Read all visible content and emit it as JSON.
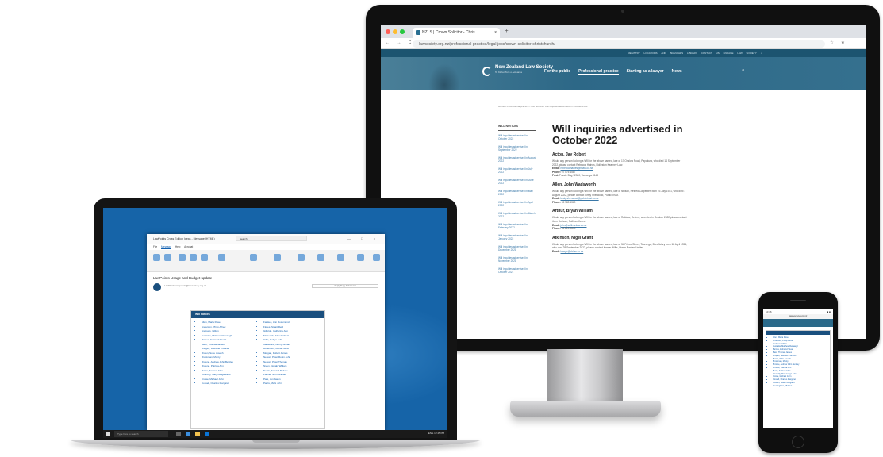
{
  "monitor": {
    "browser": {
      "tab_title": "NZLS | Crown Solicitor - Chris…",
      "tab_close": "×",
      "new_tab": "+",
      "nav_glyphs": "← → C",
      "url": "lawsociety.org.nz/professional-practice/legal-jobs/crown-solicitor-christchurch/",
      "right_glyphs": "☆ ★ ⋮"
    },
    "site": {
      "utility_links": "REGISTRY   LOCATIONS AND BRANCHES   LIBRARY   CONTACT US   ENGAGE   LAW SOCIETY ↗",
      "logo_name": "New Zealand Law Society",
      "logo_tagline": "Te Kāhui Ture o Aotearoa",
      "nav": [
        "For the public",
        "Professional practice",
        "Starting as a lawyer",
        "News"
      ],
      "active_nav_index": 1,
      "search_glyph": "⌕",
      "breadcrumb": "Home › Professional practice › Will notices › Will inquiries advertised in October 2022",
      "sidebar_heading": "WILL NOTICES",
      "sidebar_links": [
        "Will inquiries advertised in October 2022",
        "Will inquiries advertised in September 2022",
        "Will inquiries advertised in August 2022",
        "Will inquiries advertised in July 2022",
        "Will inquiries advertised in June 2022",
        "Will inquiries advertised in May 2022",
        "Will inquiries advertised in April 2022",
        "Will inquiries advertised in March 2022",
        "Will inquiries advertised in February 2022",
        "Will inquiries advertised in January 2022",
        "Will inquiries advertised in December 2021",
        "Will inquiries advertised in November 2021",
        "Will inquiries advertised in October 2021"
      ],
      "page_title": "Will inquiries advertised in October 2022",
      "entries": [
        {
          "name": "Acton, Jay Robert",
          "body": "Would any person holding a Will for the above named, late of 17 Onslow Road, Papakura, who died 14 September 2022, please contact Rebecca Haines, Rolleston Kearney Law.",
          "email": "rebecca.haines@rklaw.co.nz",
          "phone": "07 575 6587",
          "post": "Private Bag 12080, Tauranga 3143"
        },
        {
          "name": "Allen, John Wadsworth",
          "body": "Would any person holding a Will for the above named, late of Nelson, Retired Carpenter, born 23 July 1931, who died 1 August 2022, please contact Kirsty Sherwood, Public Trust.",
          "email": "kirsty.sherwood@publictrust.co.nz",
          "phone": "03 983 4360"
        },
        {
          "name": "Arthur, Bryan William",
          "body": "Would any person holding a Will for the above named, late of Rakiura, Retired, who died in October 2022 please contact John Sullivan, Sullivan Keene.",
          "email": "john@sullivanlaw.co.nz",
          "phone": "03 213 0640"
        },
        {
          "name": "Atkinson, Nigel Grant",
          "body": "Would any person holding a Will for the above named, late of 34 Prince Street, Tauranga, Beneficiary born 18 April 1954, who died 28 September 2022, please contact Karryn Willis, Home Burden Limited.",
          "email": "karryn@hblaw.co.nz"
        }
      ]
    },
    "labels": {
      "email": "Email:",
      "phone": "Phone:",
      "post": "Post:"
    }
  },
  "laptop": {
    "window_title": "LawPoints Cross Edition Ideas - Message (HTML)",
    "search_placeholder": "Search",
    "window_controls": "— □ ×",
    "menu": [
      "File",
      "Message",
      "Help",
      "Acrobat"
    ],
    "subject": "LawPoints Usage and Budget update",
    "sender": "LawPoints  lawpoints@lawsociety.org.nz",
    "reply_buttons": "Reply   Reply All   Forward",
    "card_title": "Will notices",
    "col1": [
      "Allen, Maria Rose",
      "Anderson, Philip Alfred",
      "Andrews, Gillian",
      "Australia, Matthew Reinaugh",
      "Barnes, Edmund Stuart",
      "Bass, Thomas James",
      "Bridges, Bleecker Frances",
      "Brown, Sofie Joseph",
      "Brookman, Monty",
      "Browne, Andrew John Bentley",
      "Browne, Patricia Ann",
      "Burns, Andrew John",
      "Connolly, Mary Ashga Lahu",
      "Crowe, Michael John",
      "Cossell, Charles Margaret"
    ],
    "col2": [
      "Fawkes, Ann Rosemund",
      "Flores, Stuart Reid",
      "Gilbride, Catherine Ann",
      "McCoach, John Micheal",
      "Gillis, Robyn John",
      "Maidstone, Henry William",
      "Robertson, Ronan Mina",
      "Morgan, Robert James",
      "Nelson, Peter Robin John",
      "Nelson, Peter Thomas",
      "Niven, Donald William",
      "Norrie, Edward Melville",
      "Palmer, John Graham",
      "Park, Jun Jason",
      "Parris, Mark John"
    ],
    "taskbar_search": "Type here to search",
    "clock": "ENG  12:45 PM"
  },
  "phone": {
    "status_time": "10:46",
    "status_right": "■ ■",
    "url": "lawsociety.org.nz",
    "items": [
      "Allen, Maria Rose",
      "Anderson, Philip Alfred",
      "Andrews, Gillian",
      "Australia, Matthew Reinaugh",
      "Barnes, Edmund Stuart",
      "Bass, Thomas James",
      "Bridges, Bleecker Frances",
      "Brown, Sofie Joseph",
      "Brookman, Monty",
      "Browne, Andrew John Bentley",
      "Browne, Patricia Ann",
      "Burns, Andrew John",
      "Connolly, Mary Ashga Lahu",
      "Crowe, Michael John",
      "Cossell, Charles Margaret",
      "Crossin, Gillian Margaret",
      "Cunningham, Michael"
    ]
  },
  "colors": {
    "nzls_blue": "#2b6a8a",
    "nzls_dark": "#1a4f7e",
    "link": "#3a78a8",
    "desktop_blue": "#1664a8"
  }
}
